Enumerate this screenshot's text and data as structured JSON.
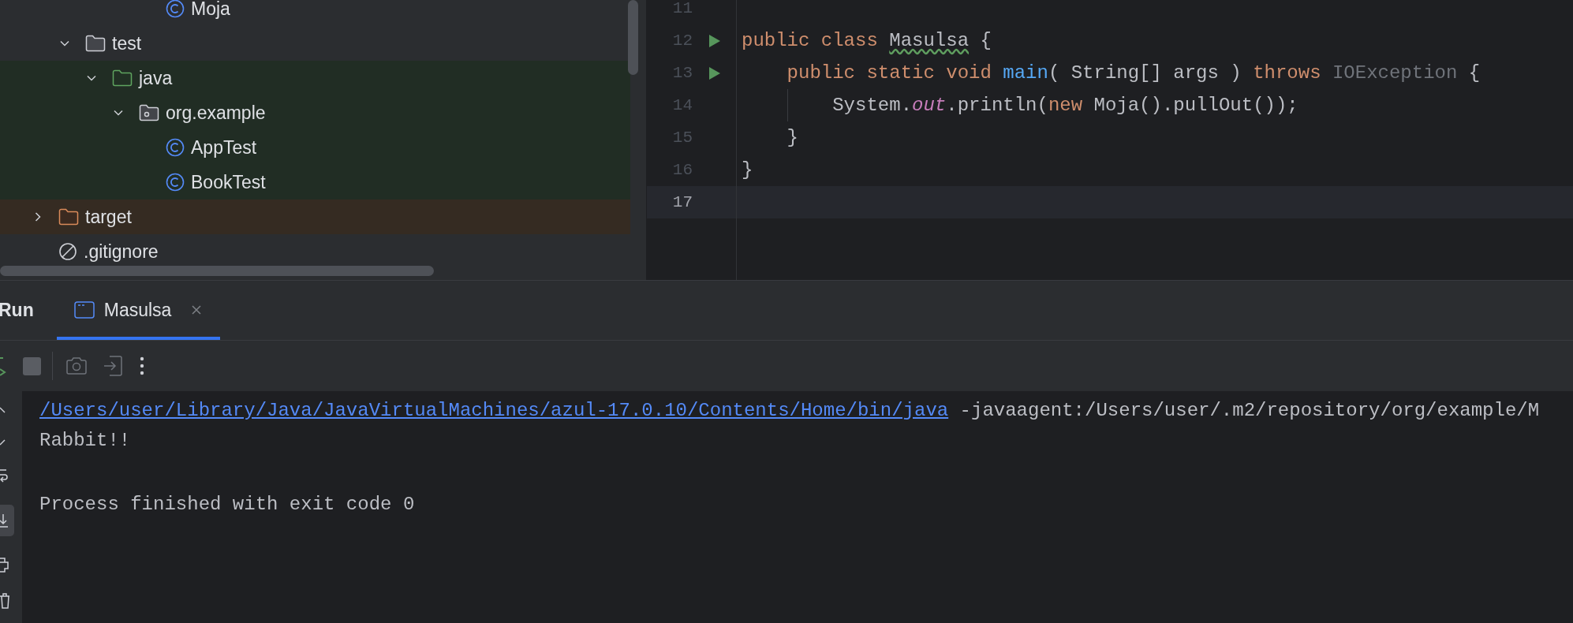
{
  "project_tree": {
    "continued_rows": [
      {
        "label": "Moja",
        "kind": "class"
      }
    ],
    "continued_nodes": [
      {
        "label": "test",
        "kind": "folder",
        "expanded": true,
        "children": [
          {
            "label": "java",
            "kind": "test_root",
            "expanded": true,
            "children": [
              {
                "label": "org.example",
                "kind": "package",
                "expanded": true,
                "children": [
                  {
                    "label": "AppTest",
                    "kind": "class"
                  },
                  {
                    "label": "BookTest",
                    "kind": "class"
                  }
                ]
              }
            ]
          }
        ]
      }
    ],
    "nodes": [
      {
        "label": "target",
        "kind": "excluded",
        "expanded": false
      },
      {
        "label": ".gitignore",
        "kind": "ignored_file"
      }
    ]
  },
  "editor": {
    "lines": [
      {
        "number": "11",
        "run": false,
        "current": false,
        "guide": false
      },
      {
        "number": "12",
        "run": true,
        "current": false,
        "guide": false,
        "tokens": [
          {
            "kind": "keyword",
            "text": "public class "
          },
          {
            "kind": "warn",
            "text": "Masulsa"
          },
          {
            "kind": "plain",
            "text": " {"
          }
        ]
      },
      {
        "number": "13",
        "run": true,
        "current": false,
        "guide": false,
        "tokens": [
          {
            "kind": "keyword",
            "text": "    public static void "
          },
          {
            "kind": "method",
            "text": "main"
          },
          {
            "kind": "plain",
            "text": "( String[] args ) "
          },
          {
            "kind": "keyword",
            "text": "throws "
          },
          {
            "kind": "unused",
            "text": "IOException"
          },
          {
            "kind": "plain",
            "text": " {"
          }
        ]
      },
      {
        "number": "14",
        "run": false,
        "current": false,
        "guide": true,
        "tokens": [
          {
            "kind": "plain",
            "text": "        System."
          },
          {
            "kind": "static",
            "text": "out"
          },
          {
            "kind": "plain",
            "text": ".println("
          },
          {
            "kind": "keyword",
            "text": "new "
          },
          {
            "kind": "plain",
            "text": "Moja().pullOut());"
          }
        ]
      },
      {
        "number": "15",
        "run": false,
        "current": false,
        "guide": false,
        "tokens": [
          {
            "kind": "plain",
            "text": "    }"
          }
        ]
      },
      {
        "number": "16",
        "run": false,
        "current": false,
        "guide": false,
        "tokens": [
          {
            "kind": "plain",
            "text": "}"
          }
        ]
      },
      {
        "number": "17",
        "run": false,
        "current": true,
        "guide": false
      }
    ]
  },
  "run_panel": {
    "title": "Run",
    "tabs": [
      {
        "label": "Masulsa",
        "selected": true
      }
    ],
    "console": [
      {
        "kind": "command",
        "link": "/Users/user/Library/Java/JavaVirtualMachines/azul-17.0.10/Contents/Home/bin/java",
        "text": " -javaagent:/Users/user/.m2/repository/org/example/M"
      },
      {
        "kind": "output",
        "text": "Rabbit!!"
      },
      {
        "kind": "exit",
        "text": "Process finished with exit code 0"
      }
    ]
  }
}
